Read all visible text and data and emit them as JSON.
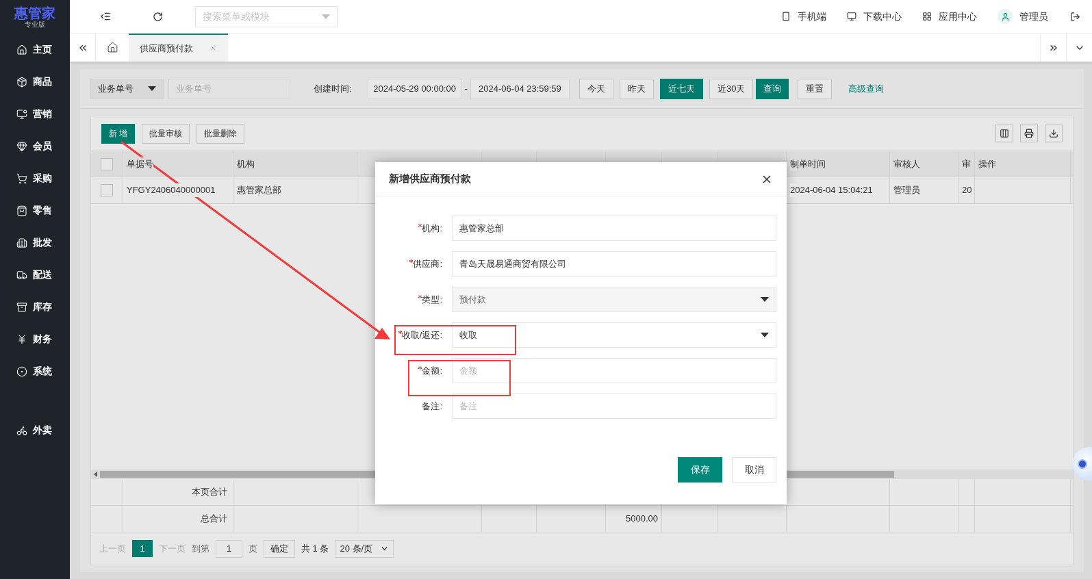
{
  "app": {
    "logo": "惠管家",
    "edition": "专业版"
  },
  "sidebar": {
    "items": [
      {
        "label": "主页"
      },
      {
        "label": "商品"
      },
      {
        "label": "营销"
      },
      {
        "label": "会员"
      },
      {
        "label": "采购"
      },
      {
        "label": "零售"
      },
      {
        "label": "批发"
      },
      {
        "label": "配送"
      },
      {
        "label": "库存"
      },
      {
        "label": "财务"
      },
      {
        "label": "系统"
      }
    ],
    "extra_items": [
      {
        "label": "外卖"
      }
    ]
  },
  "topbar": {
    "search_placeholder": "搜索菜单或模块",
    "links": [
      {
        "label": "手机端"
      },
      {
        "label": "下载中心"
      },
      {
        "label": "应用中心"
      },
      {
        "label": "管理员"
      }
    ]
  },
  "tabs": [
    {
      "label": "供应商预付款",
      "selected": true
    }
  ],
  "filters": {
    "field_select": "业务单号",
    "field_placeholder": "业务单号",
    "date_label": "创建时间:",
    "date_from": "2024-05-29 00:00:00",
    "date_separator": "-",
    "date_to": "2024-06-04 23:59:59",
    "quick_ranges": [
      {
        "label": "今天",
        "selected": false
      },
      {
        "label": "昨天",
        "selected": false
      },
      {
        "label": "近七天",
        "selected": true
      },
      {
        "label": "近30天",
        "selected": false
      }
    ],
    "search_button": "查询",
    "reset_button": "重置",
    "advanced_link": "高级查询"
  },
  "toolbar": {
    "buttons": [
      {
        "label": "新 增",
        "kind": "primary"
      },
      {
        "label": "批量审核",
        "kind": "default"
      },
      {
        "label": "批量删除",
        "kind": "default"
      }
    ]
  },
  "table": {
    "header_checked": false,
    "columns": [
      "单据号",
      "机构",
      null,
      null,
      null,
      null,
      null,
      null,
      "制单时间",
      "审核人",
      "审",
      "操作"
    ],
    "rows": [
      {
        "checked": false,
        "cells": [
          "YFGY2406040000001",
          "惠管家总部",
          null,
          null,
          null,
          null,
          null,
          null,
          "2024-06-04 15:04:21",
          "管理员",
          "20",
          null
        ]
      }
    ],
    "totals": [
      {
        "label": "本页合计"
      },
      {
        "label": "总合计",
        "amount": "5000.00"
      }
    ]
  },
  "pagination": {
    "prev": {
      "label": "上一页",
      "disabled": true
    },
    "pages": [
      {
        "label": "1",
        "selected": true
      }
    ],
    "next": {
      "label": "下一页",
      "disabled": true
    },
    "goto_label": "到第",
    "page_input": "1",
    "page_unit": "页",
    "confirm": "确定",
    "total": "共 1 条",
    "page_size": "20 条/页"
  },
  "dialog": {
    "title": "新增供应商预付款",
    "fields": [
      {
        "label": "机构:",
        "required": true,
        "kind": "text",
        "value": "惠管家总部"
      },
      {
        "label": "供应商:",
        "required": true,
        "kind": "text",
        "value": "青岛天晟易通商贸有限公司"
      },
      {
        "label": "类型:",
        "required": true,
        "kind": "select",
        "value": "预付款",
        "disabled": true
      },
      {
        "label": "收取/返还:",
        "required": true,
        "kind": "select",
        "value": "收取",
        "disabled": false
      },
      {
        "label": "金额:",
        "required": true,
        "kind": "text",
        "placeholder": "金额"
      },
      {
        "label": "备注:",
        "required": false,
        "kind": "text",
        "placeholder": "备注"
      }
    ],
    "buttons": [
      {
        "label": "保存",
        "kind": "primary"
      },
      {
        "label": "取消",
        "kind": "default"
      }
    ]
  }
}
